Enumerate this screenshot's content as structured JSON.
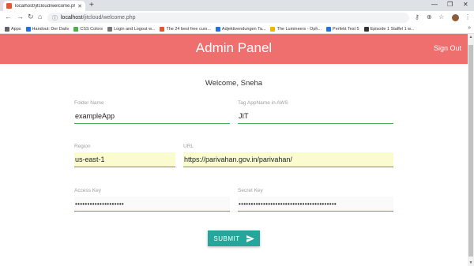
{
  "browser": {
    "tab_title": "localhost/jitcloud/welcome.php",
    "url_host": "localhost",
    "url_path": "/jitcloud/welcome.php",
    "bookmarks": [
      {
        "label": "Apps",
        "color": "#5f6368"
      },
      {
        "label": "Handout: Der Dativ",
        "color": "#1a73e8"
      },
      {
        "label": "CSS Colors",
        "color": "#4caf50"
      },
      {
        "label": "Login and Logout w...",
        "color": "#777777"
      },
      {
        "label": "The 24 best free curs...",
        "color": "#e4572e"
      },
      {
        "label": "Adjektivendungen Ta...",
        "color": "#1a73e8"
      },
      {
        "label": "The Lumineers - Oph...",
        "color": "#f4b400"
      },
      {
        "label": "Perfekt Test 5",
        "color": "#1a73e8"
      },
      {
        "label": "Episode 1 Staffel 1 w...",
        "color": "#333333"
      }
    ]
  },
  "navbar": {
    "brand": "Admin Panel",
    "signout": "Sign Out",
    "color": "#ef6e6e"
  },
  "welcome": "Welcome, Sneha",
  "form": {
    "folder": {
      "label": "Folder Name",
      "value": "exampleApp"
    },
    "tag": {
      "label": "Tag AppName in AWS",
      "value": "JIT"
    },
    "region": {
      "label": "Region",
      "value": "us-east-1"
    },
    "url": {
      "label": "URL",
      "value": "https://parivahan.gov.in/parivahan/"
    },
    "access": {
      "label": "Access Key",
      "value": "••••••••••••••••••••"
    },
    "secret": {
      "label": "Secret Key",
      "value": "••••••••••••••••••••••••••••••••••••••••"
    },
    "submit": "SUBMIT"
  },
  "icons": {
    "send": "send-icon"
  }
}
